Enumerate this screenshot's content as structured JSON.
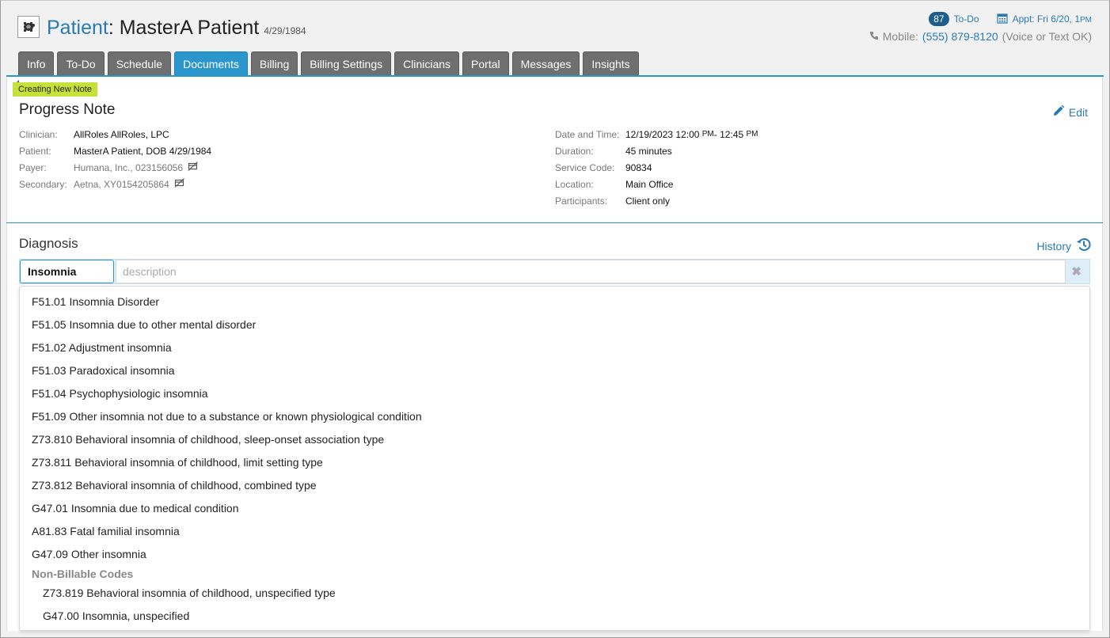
{
  "header": {
    "patient_label": "Patient",
    "patient_name": ": MasterA Patient",
    "patient_dob": "4/29/1984",
    "todo_count": "87",
    "todo_label": "To-Do",
    "appt_label": "Appt: Fri 6/20, 1",
    "appt_suffix": "PM",
    "mobile_label": "Mobile:",
    "mobile_number": "(555) 879-8120",
    "mobile_note": "(Voice or Text OK)"
  },
  "tabs": [
    {
      "label": "Info"
    },
    {
      "label": "To-Do"
    },
    {
      "label": "Schedule"
    },
    {
      "label": "Documents",
      "active": true
    },
    {
      "label": "Billing"
    },
    {
      "label": "Billing Settings"
    },
    {
      "label": "Clinicians"
    },
    {
      "label": "Portal"
    },
    {
      "label": "Messages"
    },
    {
      "label": "Insights"
    }
  ],
  "note": {
    "status_tag": "Creating New Note",
    "title": "Progress Note",
    "edit_label": "Edit",
    "left_fields": [
      {
        "key": "Clinician:",
        "value": "AllRoles AllRoles, LPC"
      },
      {
        "key": "Patient:",
        "value": "MasterA Patient, DOB 4/29/1984"
      },
      {
        "key": "Payer:",
        "value": "Humana, Inc., 023156056"
      },
      {
        "key": "Secondary:",
        "value": "Aetna, XY0154205864"
      }
    ],
    "right_fields": [
      {
        "key": "Date and Time:",
        "value": "12/19/2023 12:00",
        "pm1": "PM",
        "value2": " - 12:45",
        "pm2": "PM"
      },
      {
        "key": "Duration:",
        "value": "45 minutes"
      },
      {
        "key": "Service Code:",
        "value": "90834"
      },
      {
        "key": "Location:",
        "value": "Main Office"
      },
      {
        "key": "Participants:",
        "value": "Client only"
      }
    ]
  },
  "diagnosis": {
    "title": "Diagnosis",
    "history_label": "History",
    "code_value": "Insomnia",
    "description_placeholder": "description",
    "clear_glyph": "✖",
    "results": [
      "F51.01 Insomnia Disorder",
      "F51.05 Insomnia due to other mental disorder",
      "F51.02 Adjustment insomnia",
      "F51.03 Paradoxical insomnia",
      "F51.04 Psychophysiologic insomnia",
      "F51.09 Other insomnia not due to a substance or known physiological condition",
      "Z73.810 Behavioral insomnia of childhood, sleep-onset association type",
      "Z73.811 Behavioral insomnia of childhood, limit setting type",
      "Z73.812 Behavioral insomnia of childhood, combined type",
      "G47.01 Insomnia due to medical condition",
      "A81.83 Fatal familial insomnia",
      "G47.09 Other insomnia"
    ],
    "non_billable_label": "Non-Billable Codes",
    "non_billable": [
      "Z73.819 Behavioral insomnia of childhood, unspecified type",
      "G47.00 Insomnia, unspecified"
    ]
  },
  "icons": {
    "logo": "turtle-logo-icon",
    "calendar": "calendar-icon",
    "phone": "phone-icon",
    "edit": "pencil-icon",
    "history": "history-icon",
    "no_card": "no-card-icon"
  },
  "colors": {
    "accent": "#2b96cc",
    "link": "#2a7ab0",
    "tab_inactive": "#6f6f6f",
    "status_tag": "#c6e23a",
    "badge": "#1d5d8e"
  }
}
